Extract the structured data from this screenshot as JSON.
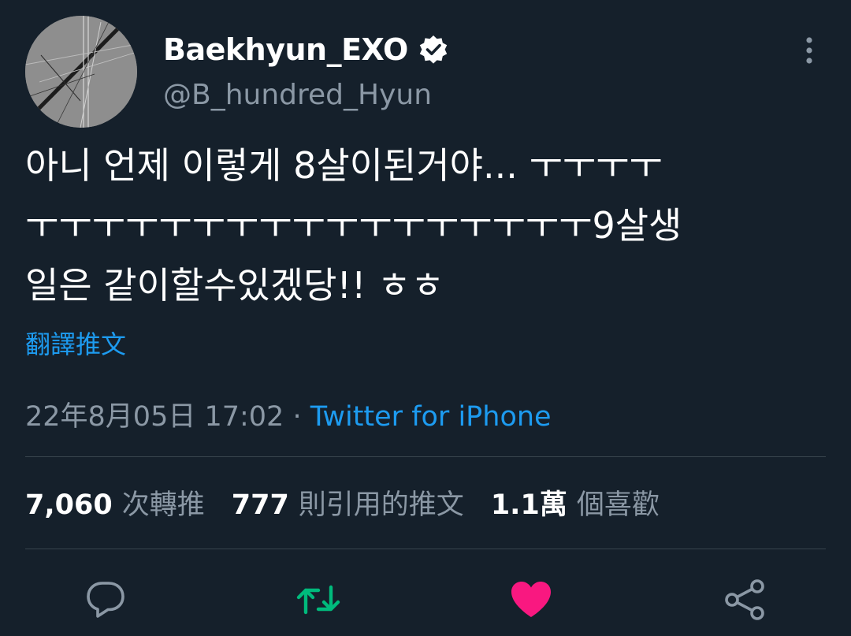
{
  "user": {
    "display_name": "Baekhyun_EXO",
    "handle": "@B_hundred_Hyun",
    "verified_icon": "verified-badge-icon"
  },
  "tweet": {
    "lines": [
      "아니 언제 이렇게 8살이된거야... ㅜㅜㅜㅜ",
      "ㅜㅜㅜㅜㅜㅜㅜㅜㅜㅜㅜㅜㅜㅜㅜㅜㅜ9살생",
      "일은 같이할수있겠당!! ㅎㅎ"
    ],
    "translate_label": "翻譯推文"
  },
  "meta": {
    "timestamp": "22年8月05日 17:02",
    "separator": "·",
    "source": "Twitter for iPhone"
  },
  "stats": {
    "retweets_count": "7,060",
    "retweets_label": "次轉推",
    "quotes_count": "777",
    "quotes_label": "則引用的推文",
    "likes_count": "1.1萬",
    "likes_label": "個喜歡"
  },
  "actions": {
    "reply_icon": "reply-icon",
    "retweet_icon": "retweet-icon",
    "like_icon": "heart-icon",
    "share_icon": "share-icon"
  },
  "colors": {
    "background": "#15202b",
    "accent": "#1d9bf0",
    "secondary_text": "#8b98a5",
    "retweet_active": "#00ba7c",
    "like_active": "#f91880",
    "divider": "#38444d"
  }
}
